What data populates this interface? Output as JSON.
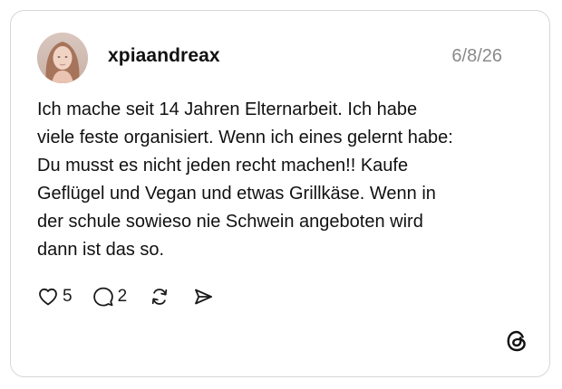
{
  "post": {
    "username": "xpiaandreax",
    "date": "6/8/26",
    "text_lines": [
      "Ich mache seit 14 Jahren Elternarbeit. Ich habe",
      "viele feste organisiert. Wenn ich eines gelernt habe:",
      "Du musst es nicht jeden recht machen!! Kaufe",
      "Geflügel und Vegan und etwas Grillkäse. Wenn in",
      "der schule sowieso nie Schwein angeboten wird",
      "dann ist das so."
    ],
    "likes": "5",
    "replies": "2"
  },
  "icons": {
    "like": "heart-icon",
    "reply": "speech-bubble-icon",
    "repost": "repost-icon",
    "share": "send-icon",
    "brand": "threads-logo-icon"
  },
  "colors": {
    "text": "#111111",
    "muted": "#8a8a8a",
    "border": "#d7d7d7"
  }
}
